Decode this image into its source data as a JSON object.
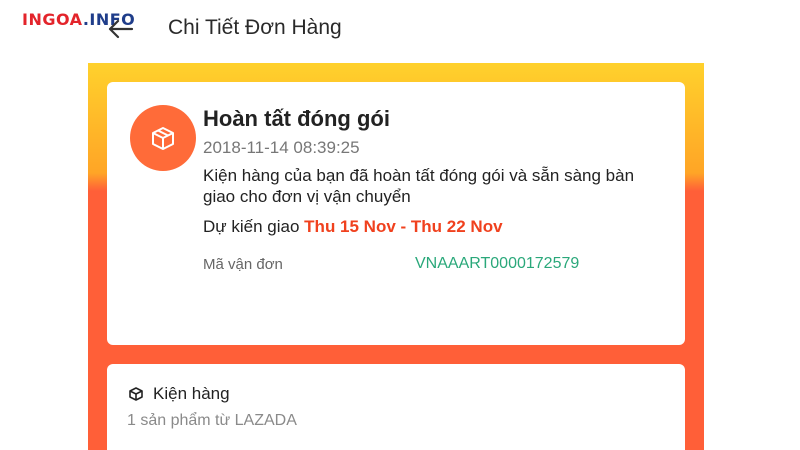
{
  "watermark": {
    "part1": "INGOA",
    "part2": ".INFO"
  },
  "header": {
    "title": "Chi Tiết Đơn Hàng",
    "back_icon": "back-arrow-icon"
  },
  "colors": {
    "accent_orange": "#ff5f38",
    "gradient_top": "#ffd12c",
    "delivery_range": "#f0411e",
    "tracking_code": "#2aa87a"
  },
  "status": {
    "icon": "package-box-icon",
    "title": "Hoàn tất đóng gói",
    "timestamp": "2018-11-14 08:39:25",
    "description": "Kiện hàng của bạn đã hoàn tất đóng gói và sẵn sàng bàn giao cho đơn vị vận chuyển",
    "delivery_label": "Dự kiến giao",
    "delivery_range": "Thu 15 Nov - Thu 22 Nov",
    "tracking_label": "Mã vận đơn",
    "tracking_code": "VNAAART0000172579"
  },
  "package": {
    "icon": "package-icon",
    "title": "Kiện hàng",
    "subtitle": "1 sản phẩm từ LAZADA"
  }
}
